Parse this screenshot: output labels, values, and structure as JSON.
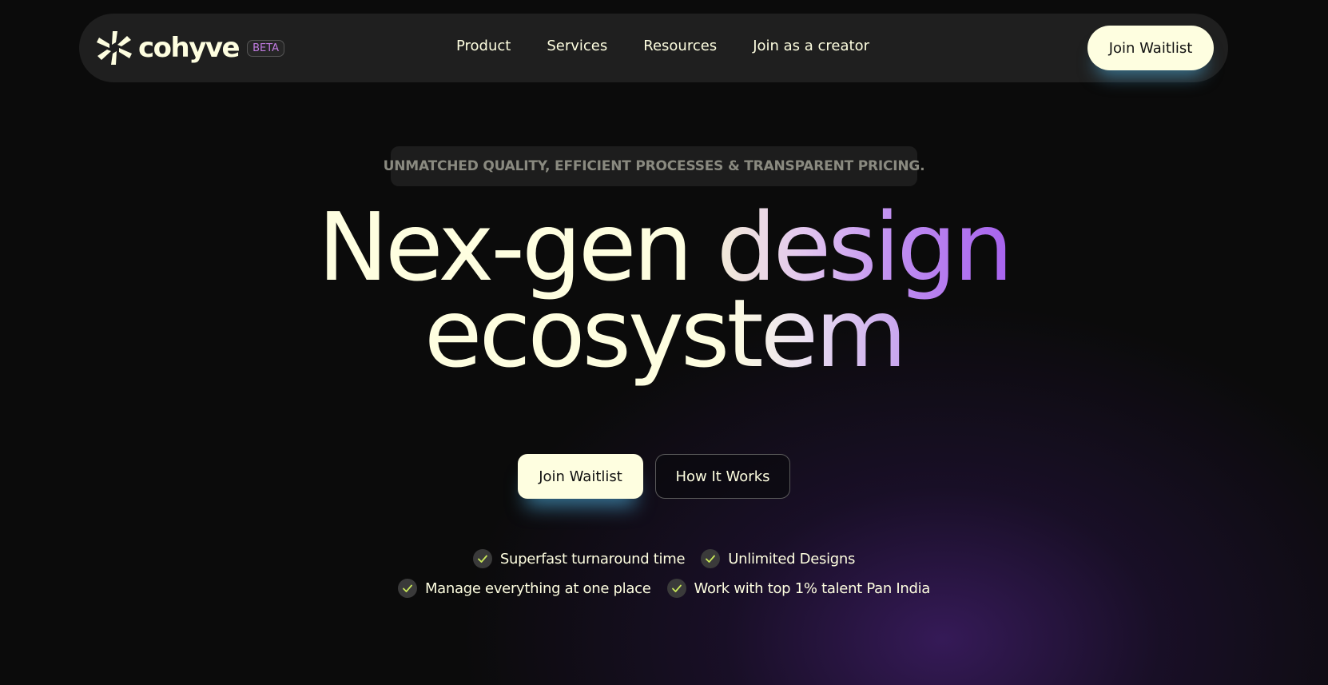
{
  "brand": {
    "name": "cohyve",
    "badge": "BETA"
  },
  "nav": {
    "links": [
      "Product",
      "Services",
      "Resources",
      "Join as a creator"
    ],
    "cta_label": "Join Waitlist"
  },
  "hero": {
    "tagline": "UNMATCHED QUALITY, EFFICIENT PROCESSES & TRANSPARENT PRICING.",
    "headline_line1_plain": "Nex-gen ",
    "headline_line1_accent": "design",
    "headline_line2_plain": "ecosys",
    "headline_line2_accent": "tem",
    "primary_cta": "Join Waitlist",
    "secondary_cta": "How It Works"
  },
  "features": [
    "Superfast turnaround time",
    "Unlimited Designs",
    "Manage everything at one place",
    "Work with top 1% talent Pan India"
  ],
  "colors": {
    "background": "#0b0b0b",
    "cream": "#fefee0",
    "accent_purple": "#a763ee",
    "check_green": "#c9e85a"
  }
}
